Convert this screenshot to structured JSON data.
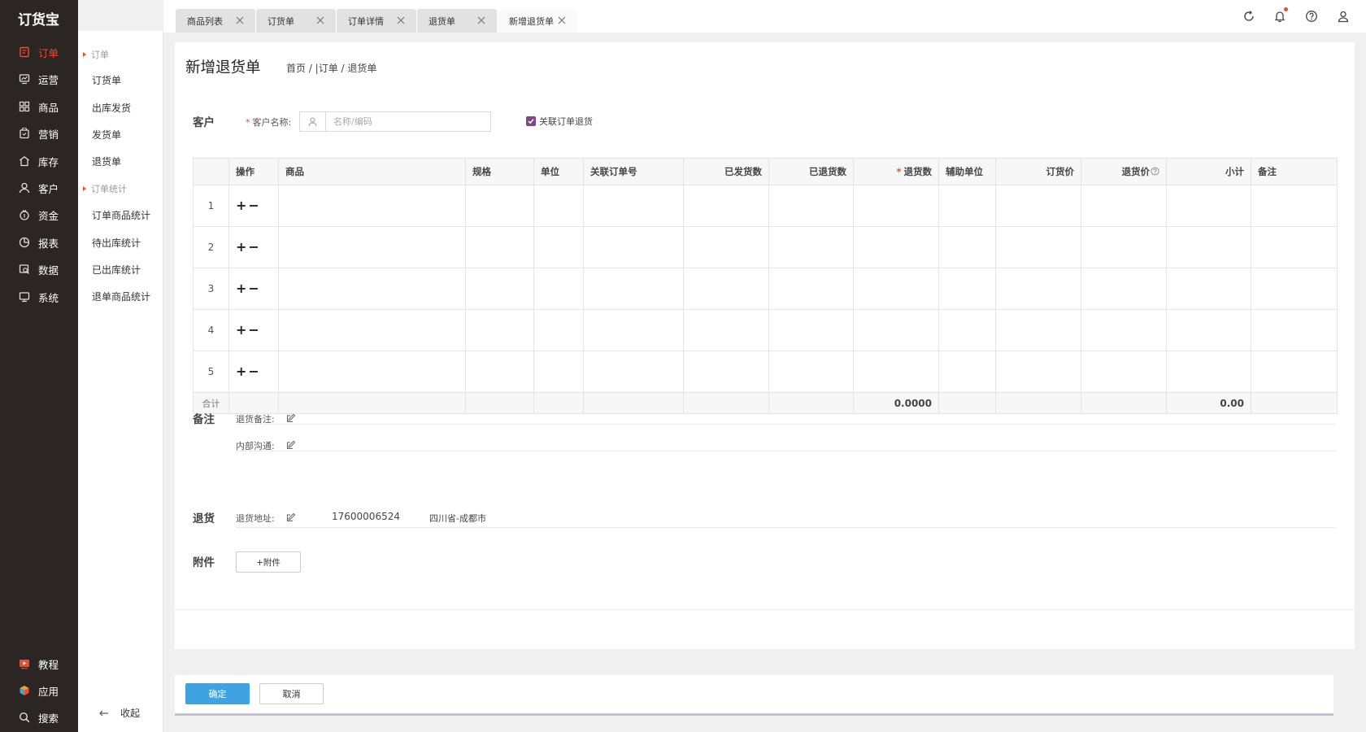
{
  "app": {
    "logo": "订货宝"
  },
  "nav": {
    "items": [
      {
        "label": "订单",
        "icon": "order-icon",
        "active": true
      },
      {
        "label": "运营",
        "icon": "operations-icon"
      },
      {
        "label": "商品",
        "icon": "goods-icon"
      },
      {
        "label": "营销",
        "icon": "marketing-icon"
      },
      {
        "label": "库存",
        "icon": "inventory-icon"
      },
      {
        "label": "客户",
        "icon": "customer-icon"
      },
      {
        "label": "资金",
        "icon": "funds-icon"
      },
      {
        "label": "报表",
        "icon": "report-icon"
      },
      {
        "label": "数据",
        "icon": "data-icon"
      },
      {
        "label": "系统",
        "icon": "system-icon"
      }
    ],
    "bottom": [
      {
        "label": "教程",
        "icon": "tutorial-icon"
      },
      {
        "label": "应用",
        "icon": "apps-icon"
      },
      {
        "label": "搜索",
        "icon": "search-icon"
      }
    ]
  },
  "submenu": {
    "group1": "订单",
    "group1_items": [
      "订货单",
      "出库发货",
      "发货单",
      "退货单"
    ],
    "group2": "订单统计",
    "group2_items": [
      "订单商品统计",
      "待出库统计",
      "已出库统计",
      "退单商品统计"
    ],
    "collapse": "收起"
  },
  "tabs": [
    {
      "label": "商品列表"
    },
    {
      "label": "订货单"
    },
    {
      "label": "订单详情"
    },
    {
      "label": "退货单"
    },
    {
      "label": "新增退货单",
      "active": true
    }
  ],
  "header": {
    "title": "新增退货单",
    "breadcrumb": "首页 / |订单 / 退货单"
  },
  "customer": {
    "section": "客户",
    "label": "客户名称:",
    "placeholder": "名称/编码",
    "link_label": "关联订单退货",
    "link_checked": true
  },
  "table": {
    "columns": [
      "操作",
      "商品",
      "规格",
      "单位",
      "关联订单号",
      "已发货数",
      "已退货数",
      "退货数",
      "辅助单位",
      "订货价",
      "退货价",
      "小计",
      "备注"
    ],
    "rows": [
      "1",
      "2",
      "3",
      "4",
      "5"
    ],
    "ops": [
      "+",
      "−"
    ],
    "sum_label": "合计",
    "sum_qty": "0.0000",
    "sum_subtotal": "0.00"
  },
  "remarks": {
    "section": "备注",
    "return_note": "退货备注:",
    "internal_note": "内部沟通:"
  },
  "return": {
    "section": "退货",
    "label": "退货地址:",
    "phone": "17600006524",
    "address": "四川省-成都市"
  },
  "attachment": {
    "section": "附件",
    "button": "+附件"
  },
  "footer": {
    "ok": "确定",
    "cancel": "取消"
  },
  "colors": {
    "accent": "#e8502f",
    "primary": "#3ea3e0",
    "nav_bg": "#2b2523"
  }
}
